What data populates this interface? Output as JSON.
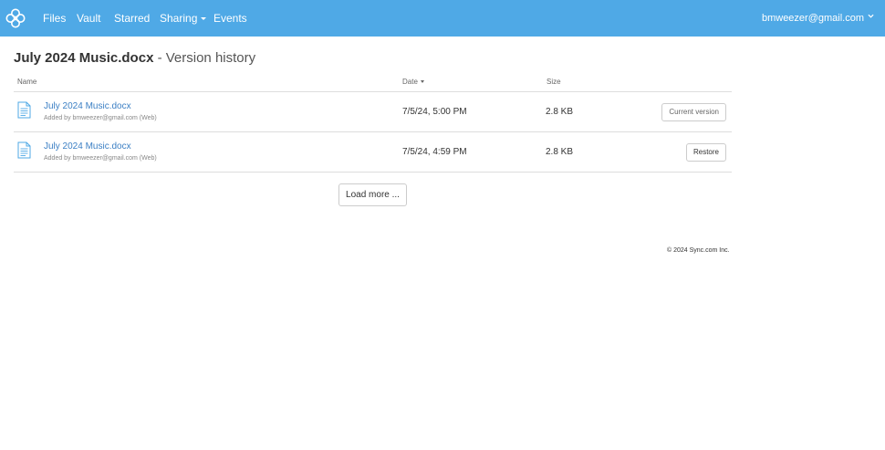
{
  "nav": {
    "items": [
      {
        "label": "Files"
      },
      {
        "label": "Vault"
      },
      {
        "label": "Starred"
      },
      {
        "label": "Sharing"
      },
      {
        "label": "Events"
      }
    ],
    "user_email": "bmweezer@gmail.com",
    "bar_color": "#4fa9e6"
  },
  "page": {
    "title_filename": "July 2024 Music.docx",
    "title_suffix": "- Version history"
  },
  "table": {
    "headers": {
      "name": "Name",
      "date": "Date",
      "size": "Size"
    },
    "rows": [
      {
        "filename": "July 2024 Music.docx",
        "added_by": "Added by bmweezer@gmail.com (Web)",
        "date": "7/5/24, 5:00 PM",
        "size": "2.8 KB",
        "action": "Current version",
        "icon": "document-icon"
      },
      {
        "filename": "July 2024 Music.docx",
        "added_by": "Added by bmweezer@gmail.com (Web)",
        "date": "7/5/24, 4:59 PM",
        "size": "2.8 KB",
        "action": "Restore",
        "icon": "document-icon"
      }
    ]
  },
  "load_more_label": "Load more ...",
  "footer": "© 2024 Sync.com Inc.",
  "colors": {
    "link": "#3b7fc4",
    "accent": "#4fa9e6"
  }
}
